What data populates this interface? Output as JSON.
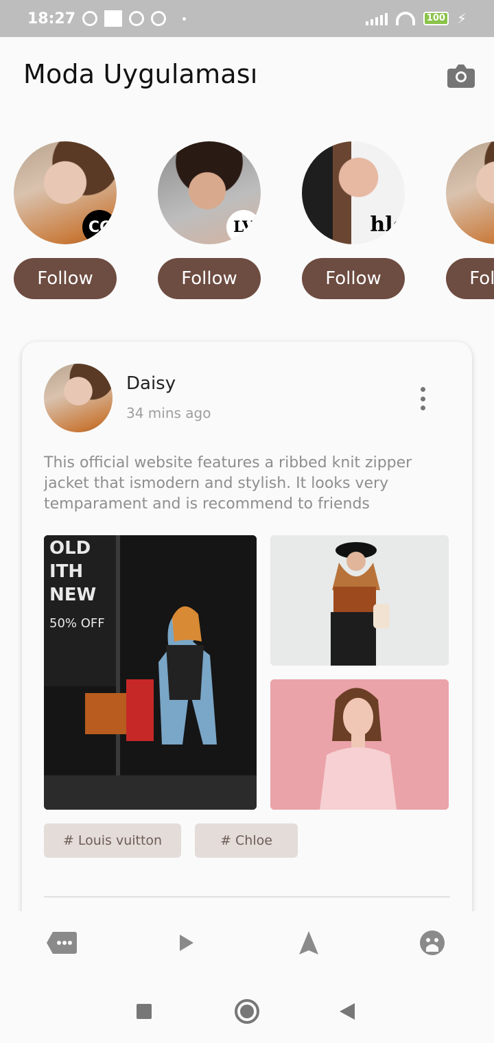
{
  "status_bar": {
    "time": "18:27",
    "battery": "100"
  },
  "header": {
    "title": "Moda Uygulaması",
    "camera_icon": "camera-icon"
  },
  "stories": [
    {
      "brand": "chanel",
      "badge_text": "CC",
      "follow_label": "Follow"
    },
    {
      "brand": "louis-vuitton",
      "badge_text": "LV",
      "follow_label": "Follow"
    },
    {
      "brand": "chloe",
      "badge_text": "hlo",
      "follow_label": "Follow"
    },
    {
      "brand": "chanel",
      "badge_text": "",
      "follow_label": "Follow"
    }
  ],
  "post": {
    "user": "Daisy",
    "time": "34 mins ago",
    "text": "This official website features a ribbed knit zipper jacket that ismodern and stylish. It looks very temparament and is recommend to friends",
    "photo_main_text": {
      "line1": "OLD",
      "line2": "ITH",
      "line3": "NEW",
      "promo": "50% OFF"
    },
    "tags": [
      "# Louis vuitton",
      "# Chloe"
    ]
  },
  "bottom_nav": [
    "chat-icon",
    "play-icon",
    "navigation-icon",
    "face-icon"
  ],
  "colors": {
    "accent": "#6d4c41",
    "tag_bg": "#e3dcd9",
    "tag_text": "#6d5c56",
    "muted_text": "#8e8e8e",
    "status_bar": "#bdbdbd"
  }
}
